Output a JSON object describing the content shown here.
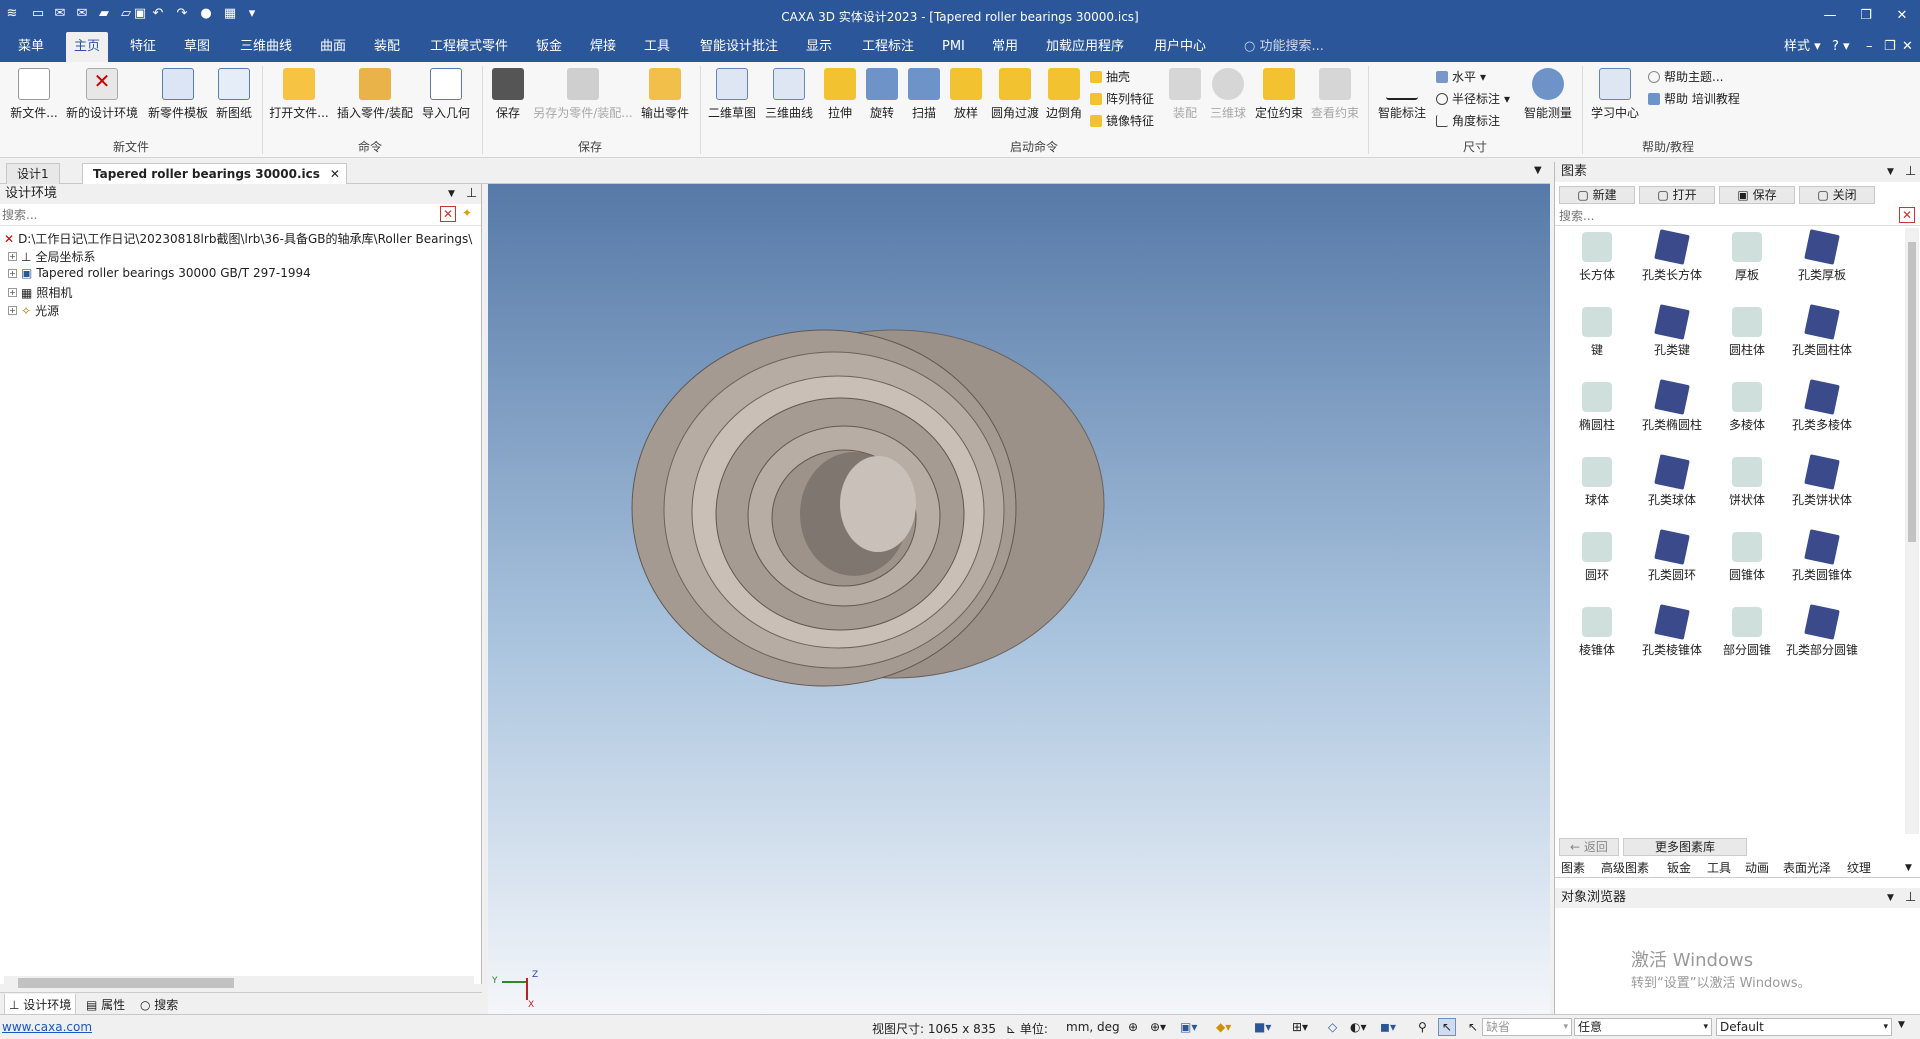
{
  "title": "CAXA 3D 实体设计2023 - [Tapered roller bearings 30000.ics]",
  "menu": [
    "菜单",
    "主页",
    "特征",
    "草图",
    "三维曲线",
    "曲面",
    "装配",
    "工程模式零件",
    "钣金",
    "焊接",
    "工具",
    "智能设计批注",
    "显示",
    "工程标注",
    "PMI",
    "常用",
    "加载应用程序",
    "用户中心"
  ],
  "menu_search": "功能搜索...",
  "style_label": "样式",
  "ribbon": {
    "new_file": [
      "新文件...",
      "新的设计环境",
      "新零件模板",
      "新图纸"
    ],
    "command": [
      "打开文件...",
      "插入零件/装配",
      "导入几何"
    ],
    "save": [
      "保存",
      "另存为零件/装配...",
      "输出零件"
    ],
    "launch": [
      "二维草图",
      "三维曲线",
      "拉伸",
      "旋转",
      "扫描",
      "放样",
      "圆角过渡",
      "边倒角"
    ],
    "launch_small": [
      "抽壳",
      "阵列特征",
      "镜像特征"
    ],
    "launch_dis": [
      "装配",
      "三维球"
    ],
    "launch_more": [
      "定位约束",
      "查看约束"
    ],
    "size": [
      "智能标注",
      "水平",
      "半径标注",
      "角度标注",
      "智能测量"
    ],
    "help": [
      "学习中心",
      "帮助主题...",
      "帮助 培训教程"
    ],
    "groups": [
      "新文件",
      "命令",
      "保存",
      "启动命令",
      "尺寸",
      "帮助/教程"
    ]
  },
  "tabs": [
    "设计1",
    "Tapered roller bearings 30000.ics"
  ],
  "left": {
    "title": "设计环境",
    "search": "搜索...",
    "tree": [
      "D:\\工作日记\\工作日记\\20230818lrb截图\\lrb\\36-具备GB的轴承库\\Roller Bearings\\",
      "全局坐标系",
      "Tapered roller bearings 30000 GB/T 297-1994",
      "照相机",
      "光源"
    ],
    "bottom_tabs": [
      "设计环境",
      "属性",
      "搜索"
    ]
  },
  "right": {
    "title": "图素",
    "buttons": [
      "新建",
      "打开",
      "保存",
      "关闭"
    ],
    "search": "搜索...",
    "items": [
      "长方体",
      "孔类长方体",
      "厚板",
      "孔类厚板",
      "键",
      "孔类键",
      "圆柱体",
      "孔类圆柱体",
      "椭圆柱",
      "孔类椭圆柱",
      "多棱体",
      "孔类多棱体",
      "球体",
      "孔类球体",
      "饼状体",
      "孔类饼状体",
      "圆环",
      "孔类圆环",
      "圆锥体",
      "孔类圆锥体",
      "棱锥体",
      "孔类棱锥体",
      "部分圆锥",
      "孔类部分圆锥"
    ],
    "back": "返回",
    "more": "更多图素库",
    "bottom_tabs": [
      "图素",
      "高级图素",
      "钣金",
      "工具",
      "动画",
      "表面光泽",
      "纹理"
    ],
    "browser_title": "对象浏览器",
    "activate_title": "激活 Windows",
    "activate_sub": "转到“设置”以激活 Windows。"
  },
  "axis": {
    "y": "Y",
    "z": "Z",
    "x": "X"
  },
  "status": {
    "link": "www.caxa.com",
    "view_size": "视图尺寸: 1065 x  835",
    "units_label": "单位:",
    "units": "mm, deg",
    "combo1": "缺省",
    "combo2": "任意",
    "combo3": "Default"
  }
}
